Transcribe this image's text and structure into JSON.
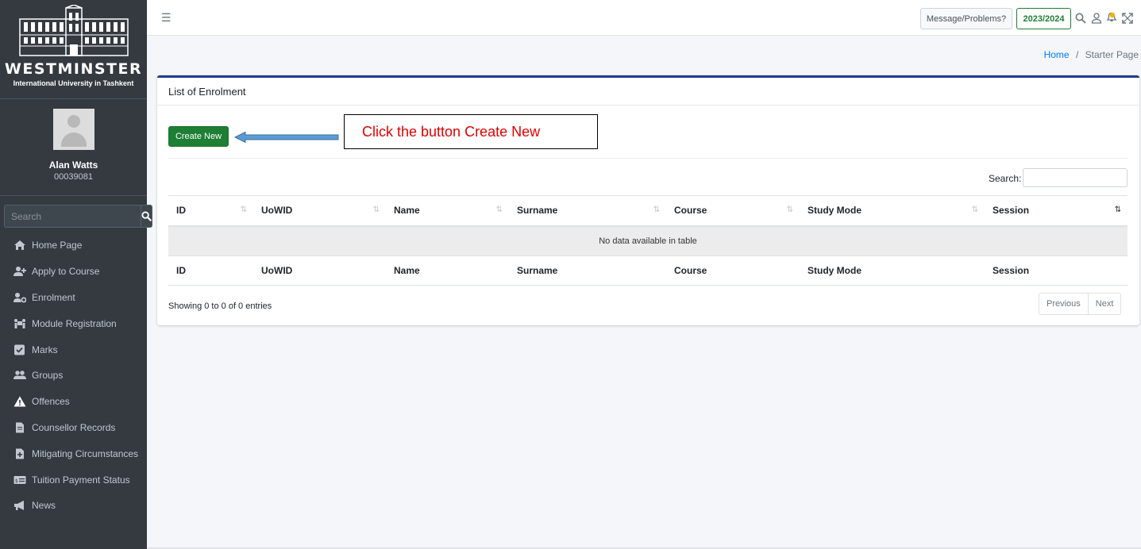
{
  "brand": {
    "name": "WESTMINSTER",
    "subtitle": "International University in Tashkent"
  },
  "user": {
    "name": "Alan Watts",
    "id": "00039081"
  },
  "sidebar_search": {
    "placeholder": "Search"
  },
  "menu": [
    {
      "label": "Home Page",
      "icon": "home-icon"
    },
    {
      "label": "Apply to Course",
      "icon": "user-plus-icon"
    },
    {
      "label": "Enrolment",
      "icon": "users-cog-icon"
    },
    {
      "label": "Module Registration",
      "icon": "people-carry-icon"
    },
    {
      "label": "Marks",
      "icon": "check-square-icon"
    },
    {
      "label": "Groups",
      "icon": "users-icon"
    },
    {
      "label": "Offences",
      "icon": "warning-icon"
    },
    {
      "label": "Counsellor Records",
      "icon": "file-icon"
    },
    {
      "label": "Mitigating Circumstances",
      "icon": "file-plus-icon"
    },
    {
      "label": "Tuition Payment Status",
      "icon": "money-card-icon"
    },
    {
      "label": "News",
      "icon": "megaphone-icon"
    }
  ],
  "topbar": {
    "message_button": "Message/Problems?",
    "year_button": "2023/2024",
    "accent_color": "#1e7e34"
  },
  "breadcrumb": {
    "home": "Home",
    "separator": "/",
    "current": "Starter Page"
  },
  "card": {
    "title": "List of Enrolment",
    "create_button": "Create New"
  },
  "callout": {
    "text": "Click the button Create New",
    "color": "#e00000"
  },
  "table": {
    "search_label": "Search:",
    "columns": [
      "ID",
      "UoWID",
      "Name",
      "Surname",
      "Course",
      "Study Mode",
      "Session"
    ],
    "empty_message": "No data available in table",
    "info": "Showing 0 to 0 of 0 entries",
    "previous": "Previous",
    "next": "Next"
  }
}
